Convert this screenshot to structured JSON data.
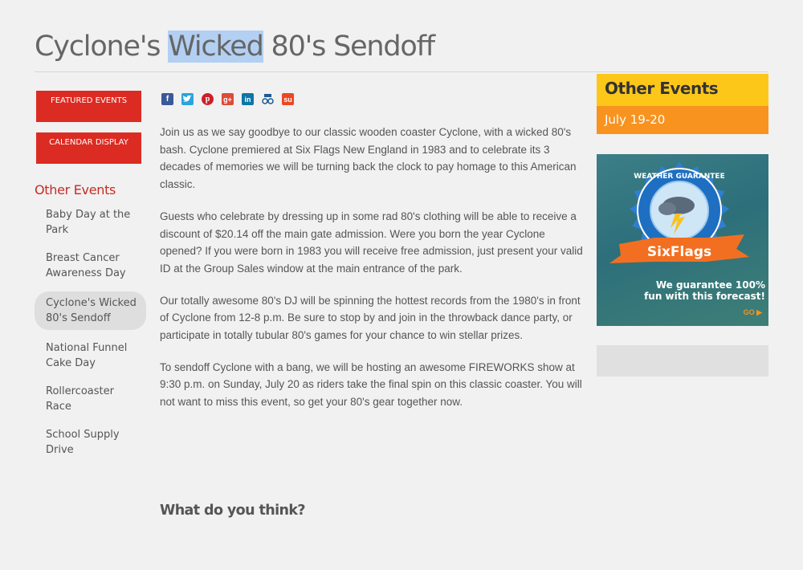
{
  "page": {
    "title_before": "Cyclone's ",
    "title_highlight": "Wicked",
    "title_after": " 80's Sendoff"
  },
  "sidebar": {
    "buttons": [
      {
        "label": "FEATURED EVENTS"
      },
      {
        "label": "CALENDAR DISPLAY"
      }
    ],
    "heading": "Other Events",
    "items": [
      {
        "label": "Baby Day at the Park"
      },
      {
        "label": "Breast Cancer Awareness Day"
      },
      {
        "label": "Cyclone's Wicked 80's Sendoff"
      },
      {
        "label": "National Funnel Cake Day"
      },
      {
        "label": "Rollercoaster Race"
      },
      {
        "label": "School Supply Drive"
      }
    ]
  },
  "share_icons": [
    "facebook-icon",
    "twitter-icon",
    "pinterest-icon",
    "google-plus-icon",
    "linkedin-icon",
    "digg-icon",
    "stumbleupon-icon"
  ],
  "main": {
    "paragraphs": [
      "Join us as we say goodbye to our classic wooden coaster Cyclone, with a wicked 80's bash. Cyclone premiered at Six Flags New England in 1983 and to celebrate its 3 decades of memories we will be turning back the clock to pay homage to this American classic.",
      "Guests who celebrate by dressing up in some rad 80's clothing will be able to receive a discount of $20.14 off the main gate admission. Were you born the year Cyclone opened? If you were born in 1983 you will receive free admission, just present your valid ID at the Group Sales window at the main entrance of the park.",
      "Our totally awesome 80's DJ will be spinning the hottest records from the 1980's in front of Cyclone from 12-8 p.m. Be sure to stop by and join in the throwback dance party, or participate in totally tubular 80's games for your chance to win stellar prizes.",
      "To sendoff Cyclone with a bang, we will be hosting an awesome FIREWORKS show at 9:30 p.m. on Sunday, July 20 as riders take the final spin on this classic coaster. You will not want to miss this event, so get your 80's gear together now."
    ],
    "comments_heading": "What do you think?"
  },
  "right": {
    "heading": "Other Events",
    "date": "July 19-20",
    "ad": {
      "badge_top": "WEATHER GUARANTEE",
      "brand": "SixFlags",
      "line1": "We guarantee 100%",
      "line2": "fun with this forecast!",
      "go": "GO ▶"
    }
  },
  "colors": {
    "accent_red": "#dc2b22",
    "heading_yellow": "#fdc71a",
    "date_orange": "#f7931e"
  }
}
